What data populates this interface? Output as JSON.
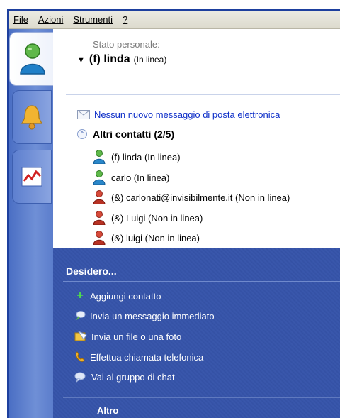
{
  "menubar": {
    "items": [
      {
        "label": "File"
      },
      {
        "label": "Azioni"
      },
      {
        "label": "Strumenti"
      },
      {
        "label": "?"
      }
    ]
  },
  "tabs": [
    {
      "icon": "messenger-buddy-icon"
    },
    {
      "icon": "bell-icon"
    },
    {
      "icon": "msn-money-icon"
    }
  ],
  "status": {
    "label": "Stato personale:",
    "name": "(f) linda",
    "state": "(In linea)"
  },
  "mail": {
    "text": "Nessun nuovo messaggio di posta elettronica"
  },
  "group": {
    "title": "Altri contatti (2/5)"
  },
  "contacts": [
    {
      "name": "(f) linda (In linea)",
      "status": "online"
    },
    {
      "name": "carlo (In linea)",
      "status": "online"
    },
    {
      "name": "(&) carlonati@invisibilmente.it (Non in linea)",
      "status": "offline"
    },
    {
      "name": "(&) Luigi (Non in linea)",
      "status": "offline"
    },
    {
      "name": "(&) luigi (Non in linea)",
      "status": "offline"
    }
  ],
  "tasks": {
    "title": "Desidero...",
    "items": [
      {
        "label": "Aggiungi contatto",
        "icon": "plus-icon"
      },
      {
        "label": "Invia un messaggio immediato",
        "icon": "message-icon"
      },
      {
        "label": "Invia un file o una foto",
        "icon": "file-photo-icon"
      },
      {
        "label": "Effettua chiamata telefonica",
        "icon": "phone-icon"
      },
      {
        "label": "Vai al gruppo di chat",
        "icon": "chat-group-icon"
      }
    ],
    "more_label": "Altro"
  },
  "colors": {
    "online": "#4aa336",
    "offline": "#c0392b",
    "panel": "#3552a6",
    "link": "#0d2ec8"
  }
}
